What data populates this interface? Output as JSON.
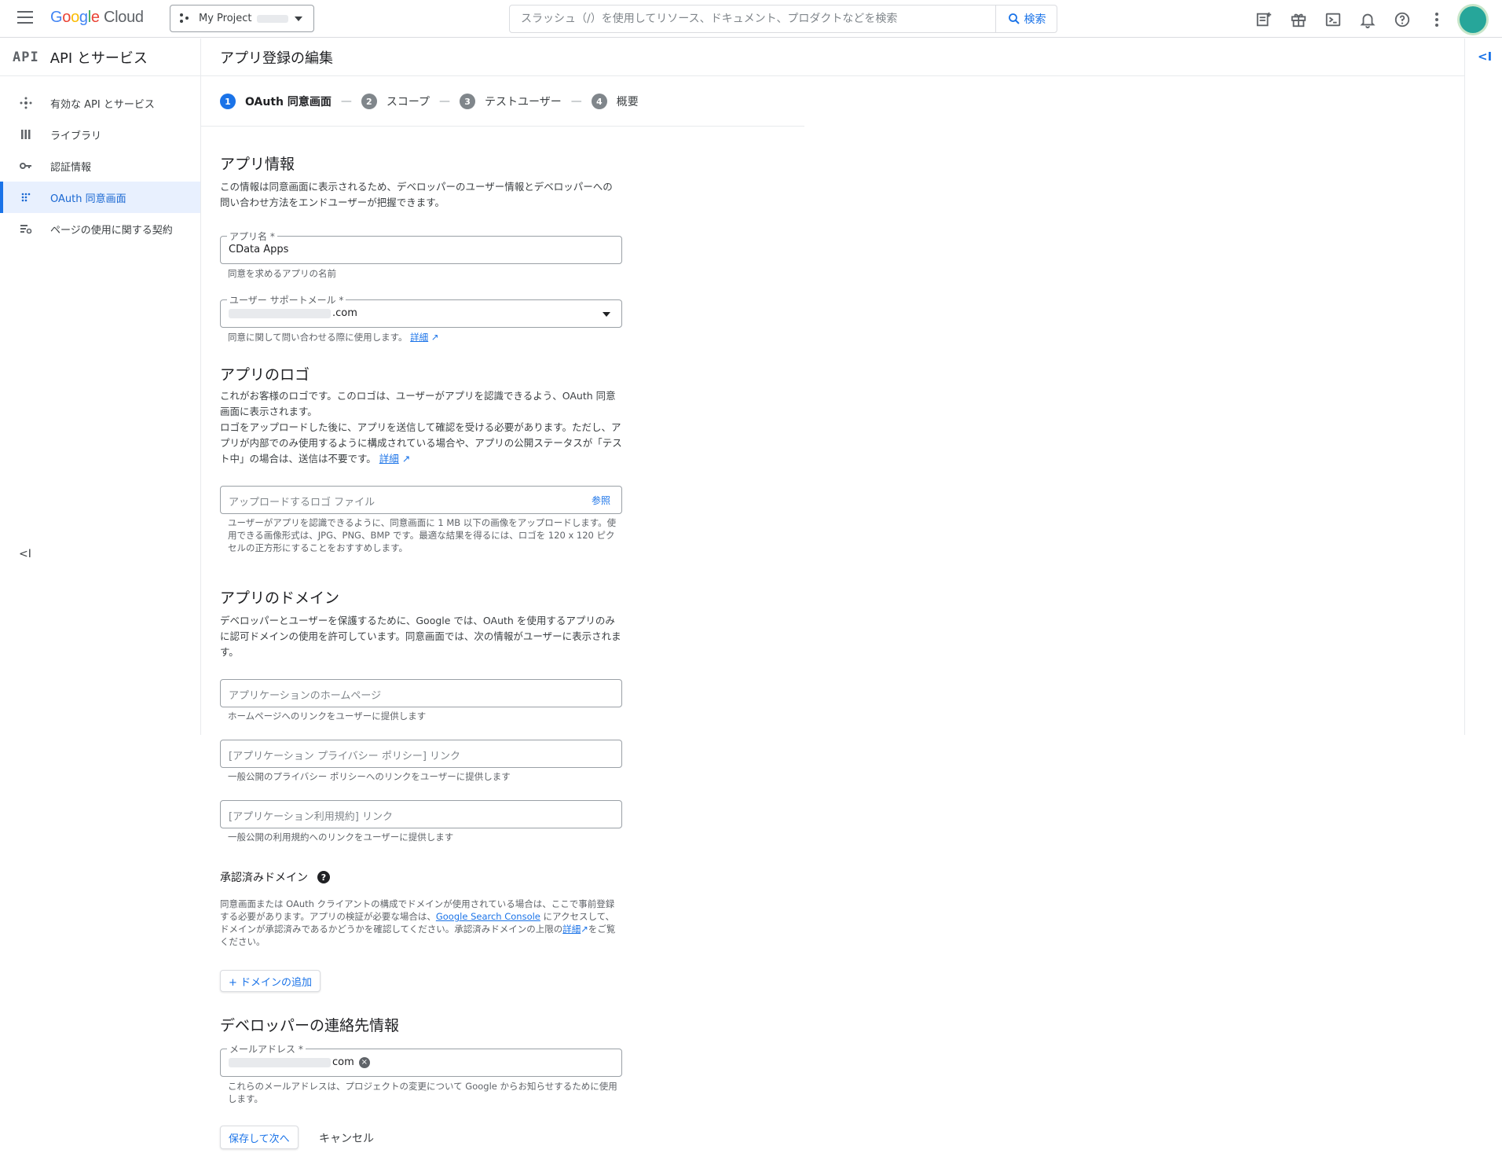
{
  "topbar": {
    "logo_g": [
      "G",
      "o",
      "o",
      "g",
      "l",
      "e"
    ],
    "logo_cloud": "Cloud",
    "project_name": "My Project",
    "search_placeholder": "スラッシュ（/）を使用してリソース、ドキュメント、プロダクトなどを検索",
    "search_button": "検索",
    "icons": [
      "notes-icon",
      "gift-icon",
      "terminal-icon",
      "bell-icon",
      "help-icon",
      "more-vert-icon"
    ]
  },
  "sidenav": {
    "api_logo": "API",
    "title": "API とサービス",
    "items": [
      {
        "label": "有効な API とサービス",
        "icon": "hub-icon",
        "active": false
      },
      {
        "label": "ライブラリ",
        "icon": "library-icon",
        "active": false
      },
      {
        "label": "認証情報",
        "icon": "key-icon",
        "active": false
      },
      {
        "label": "OAuth 同意画面",
        "icon": "consent-icon",
        "active": true
      },
      {
        "label": "ページの使用に関する契約",
        "icon": "agreement-icon",
        "active": false
      }
    ],
    "collapse_glyph": "<I"
  },
  "main": {
    "title": "アプリ登録の編集",
    "right_collapse_glyph": "<I"
  },
  "stepper": [
    {
      "num": "1",
      "label": "OAuth 同意画面",
      "active": true
    },
    {
      "num": "2",
      "label": "スコープ",
      "active": false
    },
    {
      "num": "3",
      "label": "テストユーザー",
      "active": false
    },
    {
      "num": "4",
      "label": "概要",
      "active": false
    }
  ],
  "stepper_sep": "—",
  "app_info": {
    "heading": "アプリ情報",
    "desc": "この情報は同意画面に表示されるため、デベロッパーのユーザー情報とデベロッパーへの問い合わせ方法をエンドユーザーが把握できます。",
    "app_name_label": "アプリ名 *",
    "app_name_value": "CData Apps",
    "app_name_hint": "同意を求めるアプリの名前",
    "support_email_label": "ユーザー サポートメール *",
    "support_email_suffix": ".com",
    "support_email_hint": "同意に関して問い合わせる際に使用します。",
    "details_link": "詳細"
  },
  "app_logo": {
    "heading": "アプリのロゴ",
    "desc1": "これがお客様のロゴです。このロゴは、ユーザーがアプリを認識できるよう、OAuth 同意画面に表示されます。",
    "desc2": "ロゴをアップロードした後に、アプリを送信して確認を受ける必要があります。ただし、アプリが内部でのみ使用するように構成されている場合や、アプリの公開ステータスが「テスト中」の場合は、送信は不要です。",
    "details_link": "詳細",
    "upload_placeholder": "アップロードするロゴ ファイル",
    "browse": "参照",
    "upload_hint": "ユーザーがアプリを認識できるように、同意画面に 1 MB 以下の画像をアップロードします。使用できる画像形式は、JPG、PNG、BMP です。最適な結果を得るには、ロゴを 120 x 120 ピクセルの正方形にすることをおすすめします。"
  },
  "app_domain": {
    "heading": "アプリのドメイン",
    "desc": "デベロッパーとユーザーを保護するために、Google では、OAuth を使用するアプリのみに認可ドメインの使用を許可しています。同意画面では、次の情報がユーザーに表示されます。",
    "homepage_placeholder": "アプリケーションのホームページ",
    "homepage_hint": "ホームページへのリンクをユーザーに提供します",
    "privacy_placeholder": "[アプリケーション プライバシー ポリシー] リンク",
    "privacy_hint": "一般公開のプライバシー ポリシーへのリンクをユーザーに提供します",
    "tos_placeholder": "[アプリケーション利用規約] リンク",
    "tos_hint": "一般公開の利用規約へのリンクをユーザーに提供します"
  },
  "authorized_domains": {
    "heading": "承認済みドメイン",
    "help_glyph": "?",
    "desc_a": "同意画面または OAuth クライアントの構成でドメインが使用されている場合は、ここで事前登録する必要があります。アプリの検証が必要な場合は、",
    "gsc_link": "Google Search Console",
    "desc_b": " にアクセスして、ドメインが承認済みであるかどうかを確認してください。承認済みドメインの上限の",
    "details_link": "詳細",
    "desc_c": "をご覧ください。",
    "add_domain": "+ ドメインの追加"
  },
  "developer_contact": {
    "heading": "デベロッパーの連絡先情報",
    "email_label": "メールアドレス *",
    "email_suffix": "com",
    "email_hint": "これらのメールアドレスは、プロジェクトの変更について Google からお知らせするために使用します。"
  },
  "actions": {
    "save": "保存して次へ",
    "cancel": "キャンセル"
  },
  "colors": {
    "accent": "#1a73e8",
    "nav_active_bg": "#e8f0fe",
    "avatar": "#26a69a"
  }
}
